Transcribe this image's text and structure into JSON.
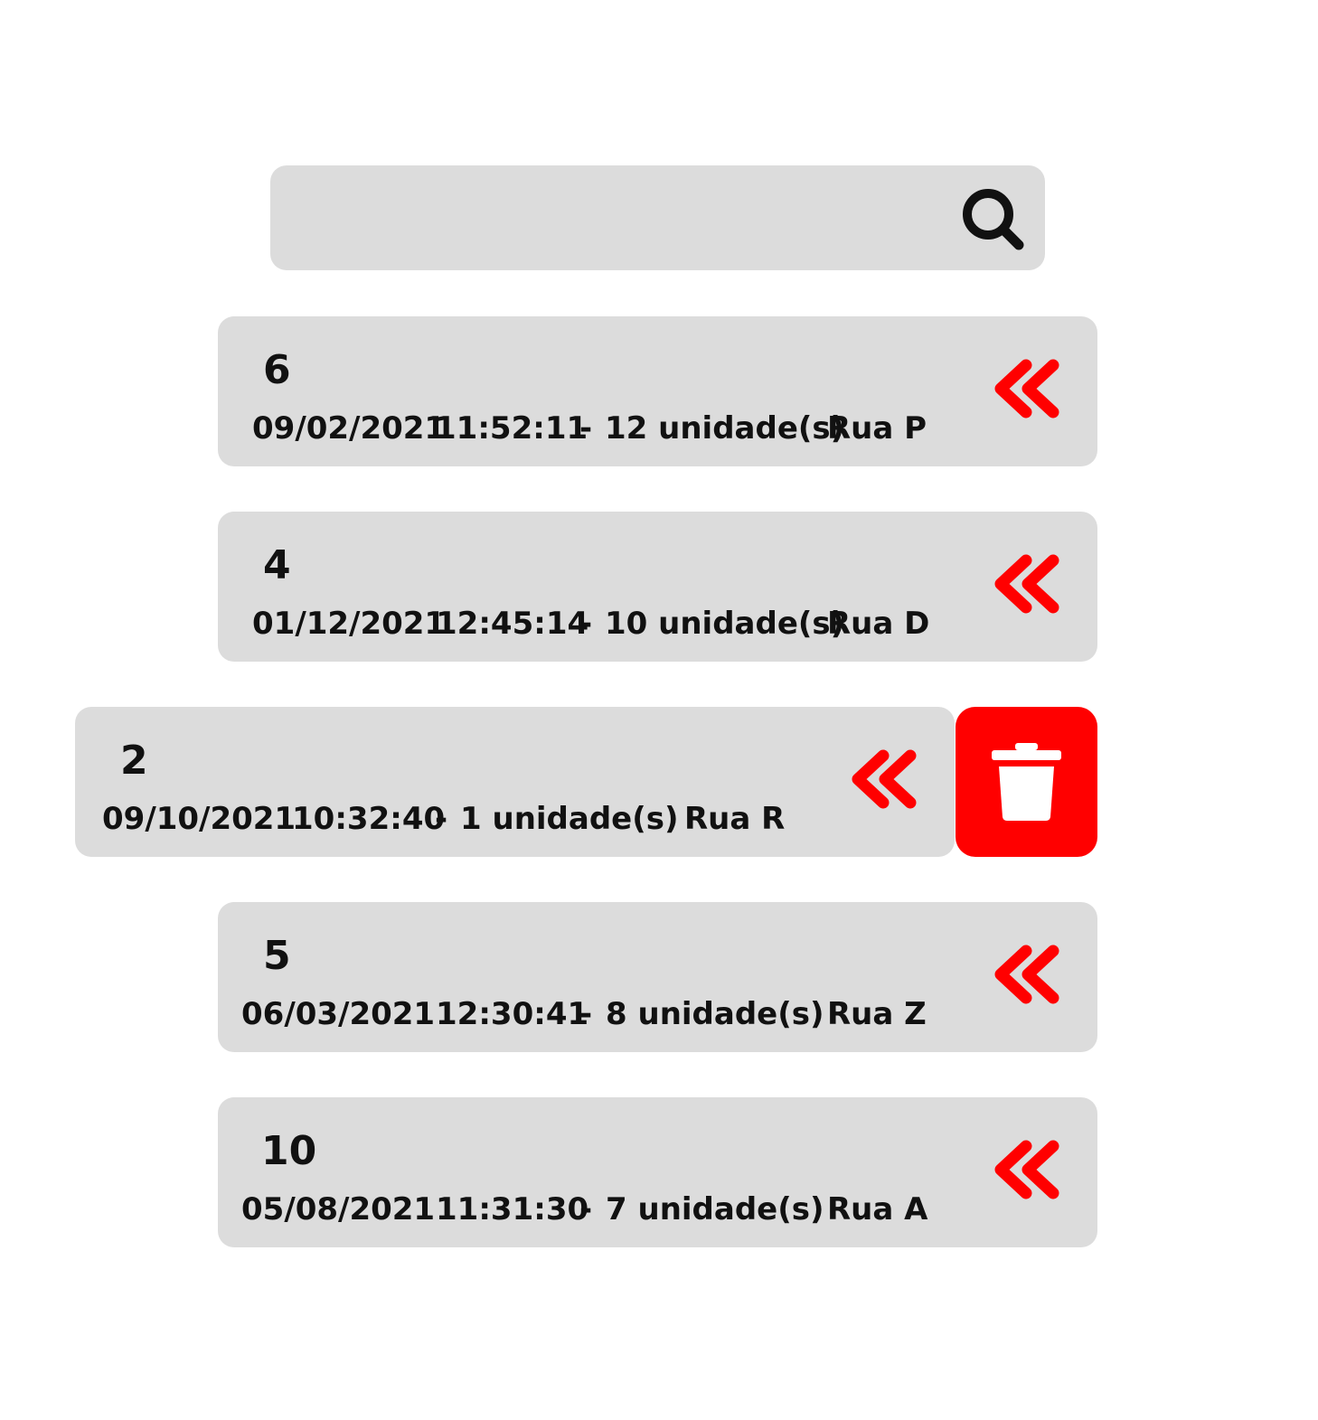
{
  "search": {
    "value": "",
    "placeholder": ""
  },
  "items": [
    {
      "number": "6",
      "date": "09/02/2021",
      "time": "11:52:11",
      "separator": "-",
      "quantity": "12 unidade(s)",
      "street": "Rua P"
    },
    {
      "number": "4",
      "date": "01/12/2021",
      "time": "12:45:14",
      "separator": "-",
      "quantity": "10 unidade(s)",
      "street": "Rua D"
    },
    {
      "number": "2",
      "date": "09/10/2021",
      "time": "10:32:40",
      "separator": "-",
      "quantity": "1 unidade(s)",
      "street": "Rua R"
    },
    {
      "number": "5",
      "date": "06/03/2021",
      "time": "12:30:41",
      "separator": "-",
      "quantity": "8 unidade(s)",
      "street": "Rua Z"
    },
    {
      "number": "10",
      "date": "05/08/2021",
      "time": "11:31:30",
      "separator": "-",
      "quantity": "7 unidade(s)",
      "street": "Rua A"
    }
  ],
  "icons": {
    "search": "search-icon",
    "expand": "chevron-double-left-icon",
    "delete": "trash-icon"
  },
  "colors": {
    "accent": "#ff0000",
    "card_background": "#dcdcdc",
    "text": "#111111"
  }
}
